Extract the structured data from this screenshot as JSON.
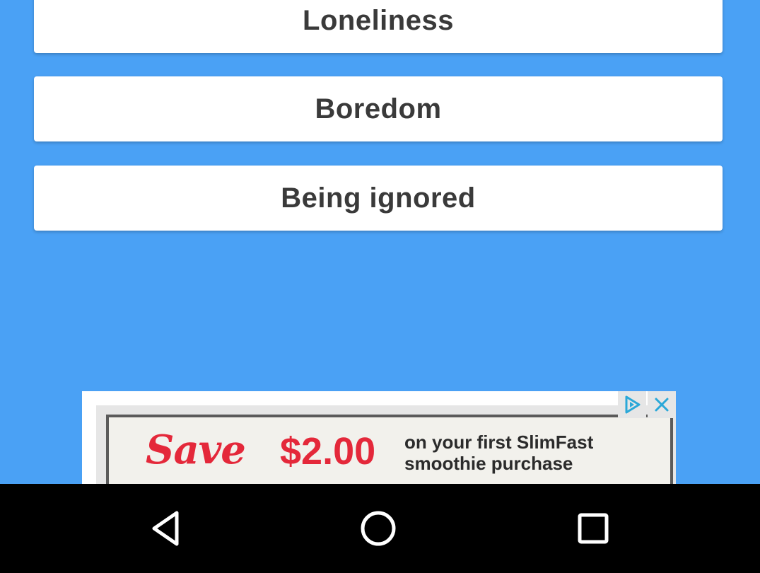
{
  "options": [
    {
      "label": "Loneliness"
    },
    {
      "label": "Boredom"
    },
    {
      "label": "Being ignored"
    }
  ],
  "ad": {
    "headline": "Save",
    "amount": "$2.00",
    "line1": "on your first SlimFast",
    "line2": "smoothie purchase",
    "adchoices_icon": "adchoices-icon",
    "close_icon": "close-icon",
    "accent_color": "#e4283a"
  },
  "navbar": {
    "back_icon": "back-triangle-icon",
    "home_icon": "home-circle-icon",
    "recents_icon": "recents-square-icon"
  },
  "colors": {
    "background": "#4aa1f5",
    "card": "#ffffff",
    "navbar": "#000000"
  }
}
